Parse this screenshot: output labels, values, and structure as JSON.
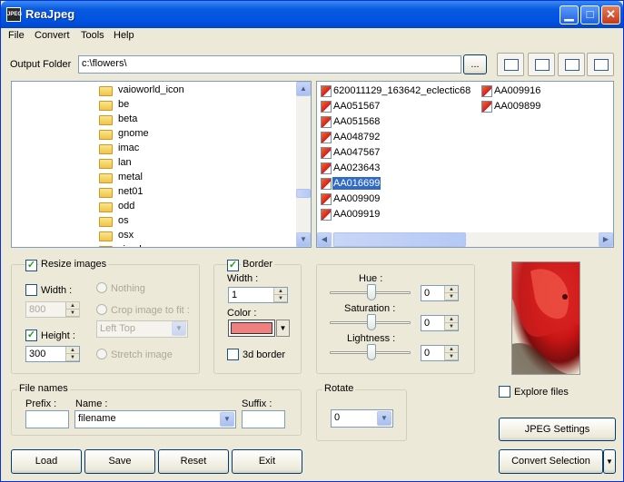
{
  "window": {
    "title": "ReaJpeg",
    "app_icon_text": "JPEG"
  },
  "menu": [
    "File",
    "Convert",
    "Tools",
    "Help"
  ],
  "output": {
    "label": "Output Folder",
    "value": "c:\\flowers\\",
    "browse_label": "..."
  },
  "view_buttons": [
    "details-view-icon",
    "list-view-icon",
    "small-icons-view-icon",
    "thumbnail-view-icon"
  ],
  "tree": {
    "items": [
      "vaioworld_icon",
      "be",
      "beta",
      "gnome",
      "imac",
      "lan",
      "metal",
      "net01",
      "odd",
      "os",
      "osx",
      "simple"
    ]
  },
  "files": {
    "col1": [
      "620011129_163642_eclectic68",
      "AA051567",
      "AA051568",
      "AA048792",
      "AA047567",
      "AA023643",
      "AA016699",
      "AA009909",
      "AA009919"
    ],
    "col2": [
      "AA009916",
      "AA009899"
    ],
    "selected": "AA016699"
  },
  "resize": {
    "group_label": "Resize images",
    "width_label": "Width :",
    "width_value": "800",
    "height_label": "Height :",
    "height_value": "300",
    "nothing_label": "Nothing",
    "crop_label": "Crop image to fit :",
    "crop_option": "Left Top",
    "stretch_label": "Stretch image"
  },
  "border": {
    "group_label": "Border",
    "width_label": "Width :",
    "width_value": "1",
    "color_label": "Color :",
    "color": "#f08080",
    "threed_label": "3d border"
  },
  "adjust": {
    "hue_label": "Hue :",
    "hue_value": "0",
    "saturation_label": "Saturation :",
    "saturation_value": "0",
    "lightness_label": "Lightness :",
    "lightness_value": "0"
  },
  "filenames": {
    "group_label": "File names",
    "prefix_label": "Prefix :",
    "prefix_value": "",
    "name_label": "Name :",
    "name_value": "filename",
    "suffix_label": "Suffix :",
    "suffix_value": ""
  },
  "rotate": {
    "group_label": "Rotate",
    "value": "0"
  },
  "explore": {
    "label": "Explore files"
  },
  "buttons": {
    "jpeg_settings": "JPEG Settings",
    "convert_selection": "Convert Selection",
    "load": "Load",
    "save": "Save",
    "reset": "Reset",
    "exit": "Exit"
  }
}
